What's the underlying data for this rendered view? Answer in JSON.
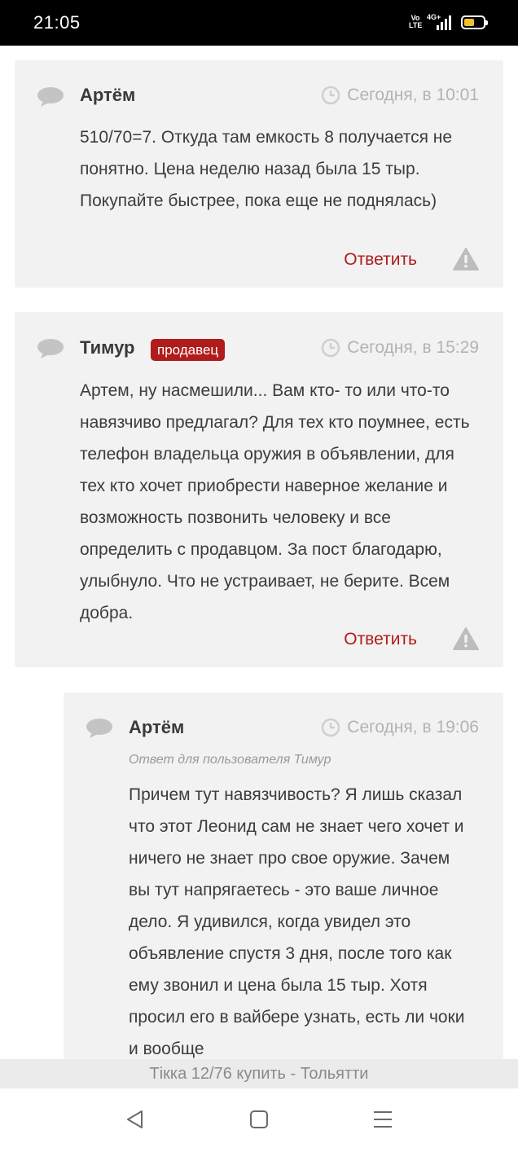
{
  "status_bar": {
    "time": "21:05",
    "volte_top": "Vo",
    "volte_bottom": "LTE",
    "network": "4G+",
    "battery_level": 0.55,
    "battery_color": "#f2c12e"
  },
  "comments": [
    {
      "author": "Артём",
      "badge": "",
      "time": "Сегодня, в 10:01",
      "reply_to": "",
      "text": "510/70=7. Откуда там емкость 8 получается не понятно. Цена неделю назад была 15 тыр. Покупайте быстрее, пока еще не поднялась)",
      "reply_label": "Ответить",
      "icons": [
        "comment-bubble-icon",
        "clock-icon",
        "warning-icon"
      ]
    },
    {
      "author": "Тимур",
      "badge": "продавец",
      "time": "Сегодня, в 15:29",
      "reply_to": "",
      "text": "Артем, ну насмешили... Вам кто- то или что-то навязчиво предлагал? Для тех кто поумнее, есть телефон владельца оружия в объявлении, для тех кто хочет приобрести наверное желание и возможность позвонить человеку и все определить с продавцом. За пост благодарю, улыбнуло. Что не устраивает, не берите. Всем добра.",
      "reply_label": "Ответить",
      "icons": [
        "comment-bubble-icon",
        "clock-icon",
        "warning-icon"
      ]
    },
    {
      "author": "Артём",
      "badge": "",
      "time": "Сегодня, в 19:06",
      "reply_to": "Ответ для пользователя Тимур",
      "text": "Причем тут навязчивость? Я лишь сказал что этот Леонид сам не знает чего хочет и ничего не знает про свое оружие. Зачем вы тут напрягаетесь - это ваше личное дело. Я удивился, когда увидел это объявление спустя 3 дня, после того как ему звонил и цена была 15 тыр. Хотя просил его в вайбере узнать, есть ли чоки и вообще",
      "reply_label": "",
      "icons": [
        "comment-bubble-icon",
        "clock-icon"
      ]
    }
  ],
  "page_title": "Tікка 12/76 купить - Тольятти",
  "nav": {
    "icons": [
      "back-triangle-icon",
      "home-square-icon",
      "menu-lines-icon"
    ]
  },
  "colors": {
    "accent_red": "#b01b1b",
    "card_bg": "#f2f2f2",
    "muted_text": "#b3b3b3"
  }
}
